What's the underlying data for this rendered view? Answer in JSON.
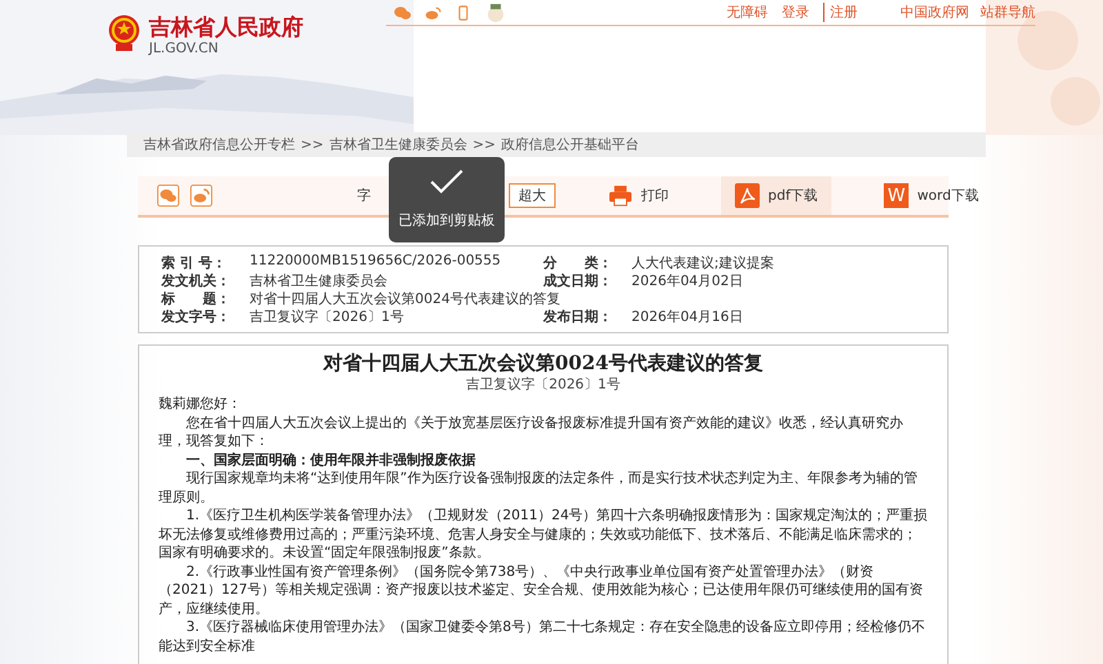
{
  "header": {
    "site_name": "吉林省人民政府",
    "domain": "JL.GOV.CN",
    "top_links": [
      {
        "label": "无障碍"
      },
      {
        "label": "登录"
      },
      {
        "label": "注册"
      }
    ],
    "right_links": [
      {
        "label": "中国政府网"
      },
      {
        "label": "站群导航"
      }
    ]
  },
  "breadcrumb": [
    "吉林省政府信息公开专栏",
    ">>",
    "吉林省卫生健康委员会",
    ">>",
    "政府信息公开基础平台"
  ],
  "toolbar": {
    "font_label": "字",
    "font_button": "超大",
    "actions": [
      {
        "kind": "print",
        "label": "打印",
        "selected": false
      },
      {
        "kind": "pdf",
        "label": "pdf下载",
        "selected": true
      },
      {
        "kind": "word",
        "label": "word下载",
        "icon_text": "W",
        "selected": false
      }
    ]
  },
  "toast": {
    "text": "已添加到剪贴板"
  },
  "meta": [
    [
      {
        "label": "索 引 号：",
        "value": "11220000MB1519656C/2026-00555"
      },
      {
        "label": "分　　类：",
        "value": "人大代表建议;建议提案"
      }
    ],
    [
      {
        "label": "发文机关：",
        "value": "吉林省卫生健康委员会"
      },
      {
        "label": "成文日期：",
        "value": "2026年04月02日"
      }
    ],
    [
      {
        "label": "标　　题：",
        "value": "对省十四届人大五次会议第0024号代表建议的答复"
      }
    ],
    [
      {
        "label": "发文字号：",
        "value": "吉卫复议字〔2026〕1号"
      },
      {
        "label": "发布日期：",
        "value": "2026年04月16日"
      }
    ]
  ],
  "article": {
    "title": "对省十四届人大五次会议第0024号代表建议的答复",
    "doc_number": "吉卫复议字〔2026〕1号",
    "greeting": "魏莉娜您好：",
    "paragraphs": [
      {
        "kind": "text",
        "text": "您在省十四届人大五次会议上提出的《关于放宽基层医疗设备报废标准提升国有资产效能的建议》收悉，经认真研究办理，现答复如下："
      },
      {
        "kind": "heading",
        "text": "一、国家层面明确：使用年限并非强制报废依据"
      },
      {
        "kind": "text",
        "text": "现行国家规章均未将“达到使用年限”作为医疗设备强制报废的法定条件，而是实行技术状态判定为主、年限参考为辅的管理原则。"
      },
      {
        "kind": "text",
        "text": "1.《医疗卫生机构医学装备管理办法》（卫规财发（2011）24号）第四十六条明确报废情形为：国家规定淘汰的；严重损坏无法修复或维修费用过高的；严重污染环境、危害人身安全与健康的；失效或功能低下、技术落后、不能满足临床需求的；国家有明确要求的。未设置“固定年限强制报废”条款。"
      },
      {
        "kind": "text",
        "text": "2.《行政事业性国有资产管理条例》（国务院令第738号）、《中央行政事业单位国有资产处置管理办法》（财资（2021）127号）等相关规定强调：资产报废以技术鉴定、安全合规、使用效能为核心；已达使用年限仍可继续使用的国有资产，应继续使用。"
      },
      {
        "kind": "text",
        "text": "3.《医疗器械临床使用管理办法》（国家卫健委令第8号）第二十七条规定：存在安全隐患的设备应立即停用；经检修仍不能达到安全标准"
      }
    ]
  }
}
